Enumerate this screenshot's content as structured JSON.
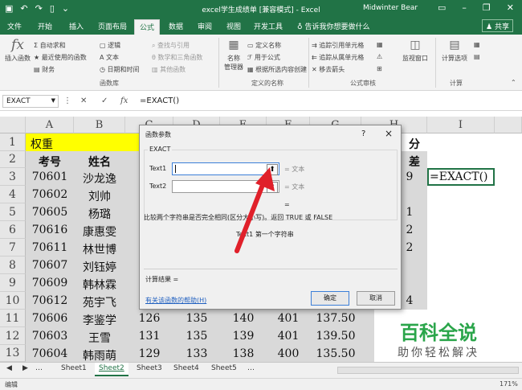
{
  "window": {
    "title": "excel学生成绩单 [兼容模式] - Excel",
    "user": "Midwinter Bear",
    "share_label": "共享"
  },
  "ribbon_tabs": [
    "文件",
    "开始",
    "插入",
    "页面布局",
    "公式",
    "数据",
    "审阅",
    "视图",
    "开发工具"
  ],
  "tell_me": "告诉我你想要做什么",
  "ribbon": {
    "insert_function": "插入函数",
    "autosum": "自动求和",
    "recent": "最近使用的函数",
    "financial": "财务",
    "logical": "逻辑",
    "text": "文本",
    "datetime": "日期和时间",
    "lookup": "查找与引用",
    "math": "数学和三角函数",
    "other": "其他函数",
    "group_library": "函数库",
    "name_manager": "名称\n管理器",
    "define_name": "定义名称",
    "use_in_formula": "用于公式",
    "create_from_sel": "根据所选内容创建",
    "group_names": "定义的名称",
    "trace_prec": "追踪引用单元格",
    "trace_dep": "追踪从属单元格",
    "remove_arrows": "移去箭头",
    "group_audit": "公式审核",
    "watch": "监视窗口",
    "calc_options": "计算选项",
    "group_calc": "计算"
  },
  "formula_bar": {
    "name_box": "EXACT",
    "formula": "=EXACT()"
  },
  "columns": [
    "A",
    "B",
    "C",
    "D",
    "E",
    "F",
    "G",
    "H",
    "I"
  ],
  "rows": [
    "1",
    "2",
    "3",
    "4",
    "5",
    "6",
    "7",
    "8",
    "9",
    "10",
    "11",
    "12",
    "13"
  ],
  "cells": {
    "a1": "权重",
    "h1": "分",
    "a2": "考号",
    "b2": "姓名",
    "h2": "差",
    "i3": "=EXACT()",
    "ids": [
      "70601",
      "70602",
      "70605",
      "70616",
      "70611",
      "70607",
      "70609",
      "70612",
      "70606",
      "70603",
      "70604"
    ],
    "names": [
      "沙龙逸",
      "刘帅",
      "杨璐",
      "康惠雯",
      "林世博",
      "刘钰婷",
      "韩林霖",
      "苑宇飞",
      "李鉴学",
      "王雪",
      "韩雨萌"
    ],
    "h_vals": [
      "9",
      "",
      "1",
      "2",
      "2",
      "",
      "",
      "4",
      "",
      "",
      ""
    ],
    "row11": [
      "126",
      "135",
      "140",
      "401",
      "137.50"
    ],
    "row12": [
      "131",
      "135",
      "139",
      "401",
      "139.50"
    ],
    "row13": [
      "129",
      "133",
      "138",
      "400",
      "135.50"
    ]
  },
  "dialog": {
    "title": "函数参数",
    "help_q": "?",
    "close": "×",
    "func_name": "EXACT",
    "arg1_label": "Text1",
    "arg2_label": "Text2",
    "arg1_hint": "= 文本",
    "arg2_hint": "= 文本",
    "result_eq": "=",
    "description": "比较两个字符串是否完全相同(区分大小写)。返回 TRUE 或 FALSE",
    "arg_desc": "Text1   第一个字符串",
    "calc_result": "计算结果 =",
    "help_link": "有关该函数的帮助(H)",
    "ok": "确定",
    "cancel": "取消"
  },
  "sheets": [
    "Sheet1",
    "Sheet2",
    "Sheet3",
    "Sheet4",
    "Sheet5"
  ],
  "status": {
    "mode": "编辑",
    "zoom": "171%"
  },
  "watermark": {
    "brand": "百科全说",
    "tagline": "助你轻松解决"
  },
  "colors": {
    "excel_green": "#217346",
    "highlight_yellow": "#ffff00",
    "arrow_red": "#e0202a",
    "watermark_green": "#2aa54a"
  }
}
